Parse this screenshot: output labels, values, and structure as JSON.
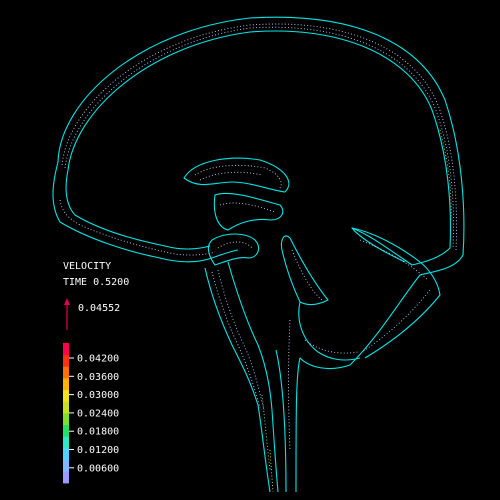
{
  "legend": {
    "quantity": "VELOCITY",
    "time": "TIME 0.5200",
    "reference_vector_value": "0.04552",
    "reference_vector_color": "#e0005a",
    "tick_labels": [
      "0.04200",
      "0.03600",
      "0.03000",
      "0.02400",
      "0.01800",
      "0.01200",
      "0.00600"
    ],
    "colorbar_colors": [
      "#9a9aff",
      "#7fb8ff",
      "#4fd2ff",
      "#2ee6c8",
      "#22e06a",
      "#7ee02a",
      "#c8e020",
      "#f0e020",
      "#ffb000",
      "#ff7000",
      "#ff3010",
      "#ff0050"
    ]
  },
  "colors": {
    "background": "#000000",
    "outline": "#00e5e5",
    "flow_low": "#c8c8ff",
    "flow_mid": "#8fd0ff",
    "flow_high": "#9ee040",
    "flow_peak": "#e8e020"
  }
}
